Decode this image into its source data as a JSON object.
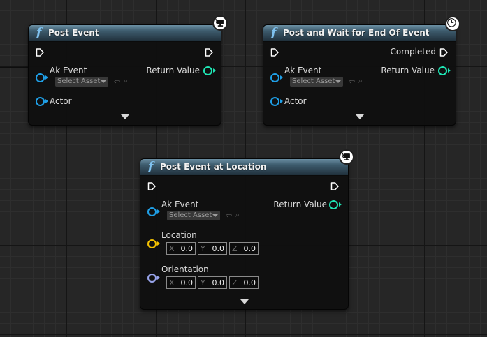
{
  "nodes": [
    {
      "title": "Post Event",
      "func_icon": "f",
      "badge": "networked-icon",
      "inputs": [
        {
          "label": "Ak Event",
          "asset_placeholder": "Select Asset"
        },
        {
          "label": "Actor"
        }
      ],
      "outputs": [
        {
          "label": "Return Value"
        }
      ]
    },
    {
      "title": "Post and Wait for End Of Event",
      "func_icon": "f",
      "badge": "clock-icon",
      "inputs": [
        {
          "label": "Ak Event",
          "asset_placeholder": "Select Asset"
        },
        {
          "label": "Actor"
        }
      ],
      "outputs": [
        {
          "label": "Completed"
        },
        {
          "label": "Return Value"
        }
      ]
    },
    {
      "title": "Post Event at Location",
      "func_icon": "f",
      "badge": "networked-icon",
      "inputs": [
        {
          "label": "Ak Event",
          "asset_placeholder": "Select Asset"
        },
        {
          "label": "Location",
          "x_axis": "X",
          "x": "0.0",
          "y_axis": "Y",
          "y": "0.0",
          "z_axis": "Z",
          "z": "0.0"
        },
        {
          "label": "Orientation",
          "x_axis": "X",
          "x": "0.0",
          "y_axis": "Y",
          "y": "0.0",
          "z_axis": "Z",
          "z": "0.0"
        }
      ],
      "outputs": [
        {
          "label": "Return Value"
        }
      ]
    }
  ],
  "colors": {
    "object_pin": "#1fa0e8",
    "int_pin": "#1fe6b4",
    "vector_pin": "#f5c200",
    "rotator_pin": "#9aa6ee",
    "exec_pin": "#ffffff"
  }
}
